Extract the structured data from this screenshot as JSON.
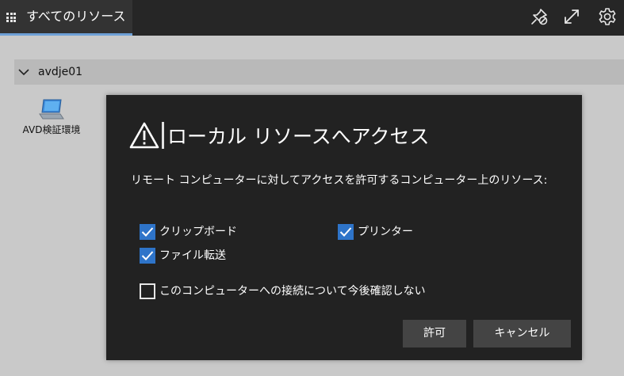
{
  "topbar": {
    "tab_label": "すべてのリソース",
    "icons": [
      "unpin-icon",
      "expand-icon",
      "gear-icon"
    ]
  },
  "group": {
    "name": "avdje01"
  },
  "resource": {
    "label": "AVD検証環境",
    "icon": "computer-icon"
  },
  "dialog": {
    "title": "ローカル リソースへアクセス",
    "description": "リモート コンピューターに対してアクセスを許可するコンピューター上のリソース:",
    "checkboxes": {
      "clipboard": {
        "label": "クリップボード",
        "checked": true
      },
      "printer": {
        "label": "プリンター",
        "checked": true
      },
      "file_transfer": {
        "label": "ファイル転送",
        "checked": true
      },
      "dont_ask": {
        "label": "このコンピューターへの接続について今後確認しない",
        "checked": false
      }
    },
    "allow_label": "許可",
    "cancel_label": "キャンセル"
  },
  "colors": {
    "accent": "#2e74c9",
    "tab_underline": "#6ea0d6",
    "dialog_bg": "#222222",
    "page_bg": "#c9c9c9"
  }
}
